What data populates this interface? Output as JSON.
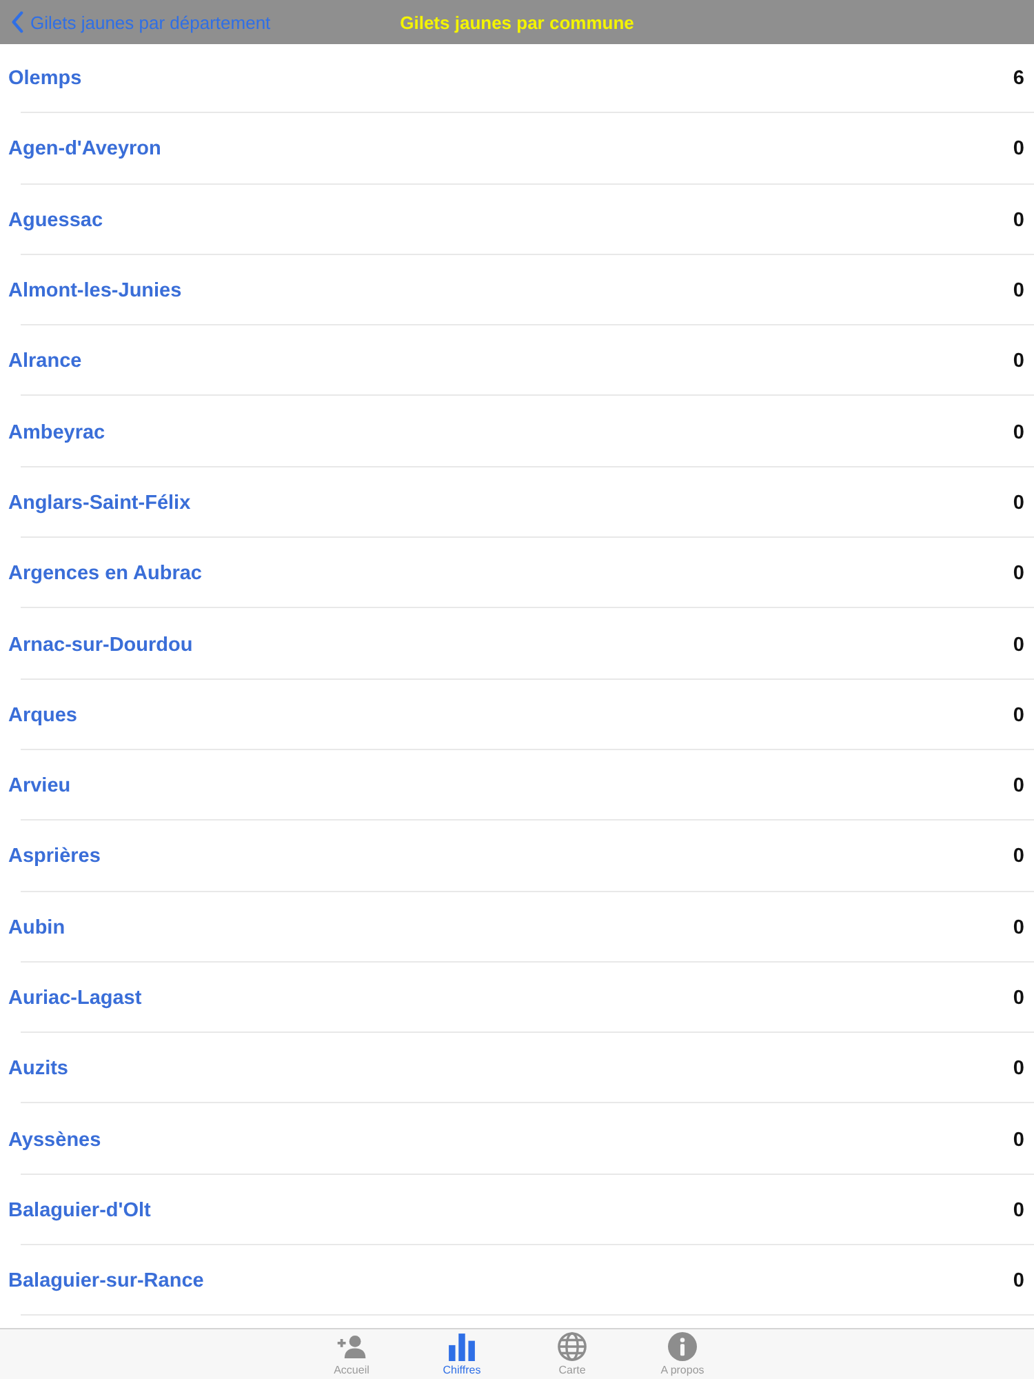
{
  "nav_bar": {
    "back_label": "Gilets jaunes par département",
    "title": "Gilets jaunes par commune"
  },
  "communes": [
    {
      "name": "Olemps",
      "count": "6"
    },
    {
      "name": "Agen-d'Aveyron",
      "count": "0"
    },
    {
      "name": "Aguessac",
      "count": "0"
    },
    {
      "name": "Almont-les-Junies",
      "count": "0"
    },
    {
      "name": "Alrance",
      "count": "0"
    },
    {
      "name": "Ambeyrac",
      "count": "0"
    },
    {
      "name": "Anglars-Saint-Félix",
      "count": "0"
    },
    {
      "name": "Argences en Aubrac",
      "count": "0"
    },
    {
      "name": "Arnac-sur-Dourdou",
      "count": "0"
    },
    {
      "name": "Arques",
      "count": "0"
    },
    {
      "name": "Arvieu",
      "count": "0"
    },
    {
      "name": "Asprières",
      "count": "0"
    },
    {
      "name": "Aubin",
      "count": "0"
    },
    {
      "name": "Auriac-Lagast",
      "count": "0"
    },
    {
      "name": "Auzits",
      "count": "0"
    },
    {
      "name": "Ayssènes",
      "count": "0"
    },
    {
      "name": "Balaguier-d'Olt",
      "count": "0"
    },
    {
      "name": "Balaguier-sur-Rance",
      "count": "0"
    }
  ],
  "tab_bar": [
    {
      "kind": "person-add",
      "label": "Accueil",
      "selected": false
    },
    {
      "kind": "chart",
      "label": "Chiffres",
      "selected": true
    },
    {
      "kind": "globe",
      "label": "Carte",
      "selected": false
    },
    {
      "kind": "info",
      "label": "A propos",
      "selected": false
    }
  ]
}
